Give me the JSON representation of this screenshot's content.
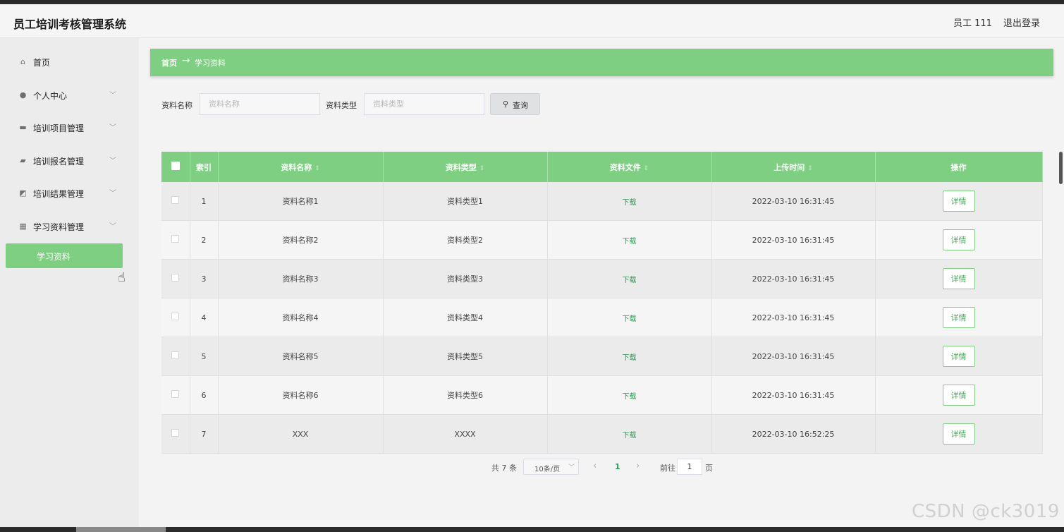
{
  "header": {
    "title": "员工培训考核管理系统",
    "user": "员工 111",
    "logout": "退出登录"
  },
  "sidebar": {
    "items": [
      {
        "label": "首页",
        "icon": "home-icon",
        "glyph": "⌂"
      },
      {
        "label": "个人中心",
        "icon": "user-icon",
        "glyph": "●"
      },
      {
        "label": "培训项目管理",
        "icon": "chat-icon",
        "glyph": "▬"
      },
      {
        "label": "培训报名管理",
        "icon": "flag-icon",
        "glyph": "▰"
      },
      {
        "label": "培训结果管理",
        "icon": "chart-icon",
        "glyph": "◩"
      },
      {
        "label": "学习资料管理",
        "icon": "grid-icon",
        "glyph": "▦"
      }
    ],
    "sub_active": "学习资料"
  },
  "breadcrumb": {
    "home": "首页",
    "separator": "→",
    "current": "学习资料"
  },
  "search": {
    "name_label": "资料名称",
    "name_placeholder": "资料名称",
    "type_label": "资料类型",
    "type_placeholder": "资料类型",
    "button": "查询"
  },
  "table": {
    "headers": [
      "索引",
      "资料名称",
      "资料类型",
      "资料文件",
      "上传时间",
      "操作"
    ],
    "rows": [
      {
        "index": "1",
        "name": "资料名称1",
        "type": "资料类型1",
        "file": "下载",
        "time": "2022-03-10 16:31:45",
        "action": "详情"
      },
      {
        "index": "2",
        "name": "资料名称2",
        "type": "资料类型2",
        "file": "下载",
        "time": "2022-03-10 16:31:45",
        "action": "详情"
      },
      {
        "index": "3",
        "name": "资料名称3",
        "type": "资料类型3",
        "file": "下载",
        "time": "2022-03-10 16:31:45",
        "action": "详情"
      },
      {
        "index": "4",
        "name": "资料名称4",
        "type": "资料类型4",
        "file": "下载",
        "time": "2022-03-10 16:31:45",
        "action": "详情"
      },
      {
        "index": "5",
        "name": "资料名称5",
        "type": "资料类型5",
        "file": "下载",
        "time": "2022-03-10 16:31:45",
        "action": "详情"
      },
      {
        "index": "6",
        "name": "资料名称6",
        "type": "资料类型6",
        "file": "下载",
        "time": "2022-03-10 16:31:45",
        "action": "详情"
      },
      {
        "index": "7",
        "name": "XXX",
        "type": "XXXX",
        "file": "下载",
        "time": "2022-03-10 16:52:25",
        "action": "详情"
      }
    ]
  },
  "pagination": {
    "total": "共 7 条",
    "page_size": "10条/页",
    "current": "1",
    "goto": "前往",
    "goto_value": "1",
    "unit": "页"
  },
  "watermark": "CSDN @ck3019",
  "colors": {
    "accent": "#7ecf82",
    "link": "#2a9a52"
  }
}
